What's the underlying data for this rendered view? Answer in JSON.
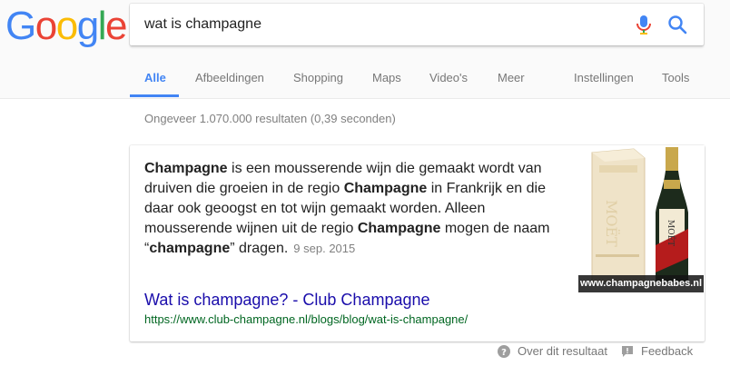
{
  "logo": {
    "letters": [
      "G",
      "o",
      "o",
      "g",
      "l",
      "e"
    ],
    "colors": [
      "#4285F4",
      "#EA4335",
      "#FBBC05",
      "#4285F4",
      "#34A853",
      "#EA4335"
    ]
  },
  "search": {
    "query": "wat is champagne"
  },
  "tabs": [
    {
      "label": "Alle",
      "active": true
    },
    {
      "label": "Afbeeldingen"
    },
    {
      "label": "Shopping"
    },
    {
      "label": "Maps"
    },
    {
      "label": "Video's"
    },
    {
      "label": "Meer"
    },
    {
      "label": "Instellingen"
    },
    {
      "label": "Tools"
    }
  ],
  "result_stats": "Ongeveer 1.070.000 resultaten (0,39 seconden)",
  "featured_snippet": {
    "parts": [
      {
        "text": "Champagne",
        "bold": true
      },
      {
        "text": " is een mousserende wijn die gemaakt wordt van druiven die groeien in de regio ",
        "bold": false
      },
      {
        "text": "Champagne",
        "bold": true
      },
      {
        "text": " in Frankrijk en die daar ook geoogst en tot wijn gemaakt worden. Alleen mousserende wijnen uit de regio ",
        "bold": false
      },
      {
        "text": "Champagne",
        "bold": true
      },
      {
        "text": " mogen de naam “",
        "bold": false
      },
      {
        "text": "champagne",
        "bold": true
      },
      {
        "text": "” dragen.",
        "bold": false
      }
    ],
    "date": "9 sep. 2015",
    "image_caption": "www.champagnebabes.nl",
    "result_title": "Wat is champagne? - Club Champagne",
    "result_url": "https://www.club-champagne.nl/blogs/blog/wat-is-champagne/"
  },
  "footer": {
    "about": "Over dit resultaat",
    "feedback": "Feedback"
  },
  "colors": {
    "tab_active": "#4285f4",
    "link": "#1a0dab",
    "url": "#006621",
    "muted": "#808080"
  }
}
